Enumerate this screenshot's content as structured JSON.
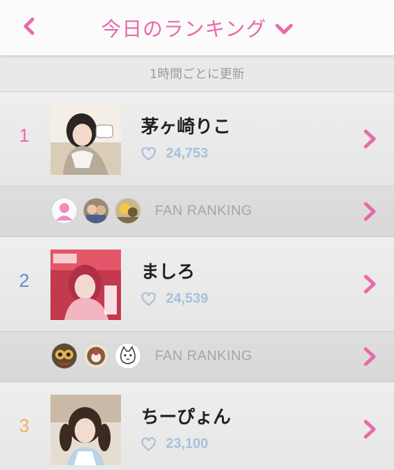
{
  "header": {
    "title": "今日のランキング",
    "back_icon": "chevron-left-icon",
    "dropdown_icon": "chevron-down-icon",
    "accent_color": "#e86aa9"
  },
  "update_note": "1時間ごとに更新",
  "rankings": [
    {
      "rank": "1",
      "rank_color": "#e86aa9",
      "name": "茅ヶ崎りこ",
      "likes": "24,753",
      "fan_label": "FAN RANKING"
    },
    {
      "rank": "2",
      "rank_color": "#5b8fd6",
      "name": "ましろ",
      "likes": "24,539",
      "fan_label": "FAN RANKING"
    },
    {
      "rank": "3",
      "rank_color": "#f0b25a",
      "name": "ちーぴょん",
      "likes": "23,100"
    }
  ],
  "icons": {
    "heart": "heart-icon",
    "row_arrow": "chevron-right-icon",
    "default_avatar": "user-silhouette-icon"
  },
  "colors": {
    "like_count": "#a8c0dd",
    "chevron": "#e86aa9"
  }
}
